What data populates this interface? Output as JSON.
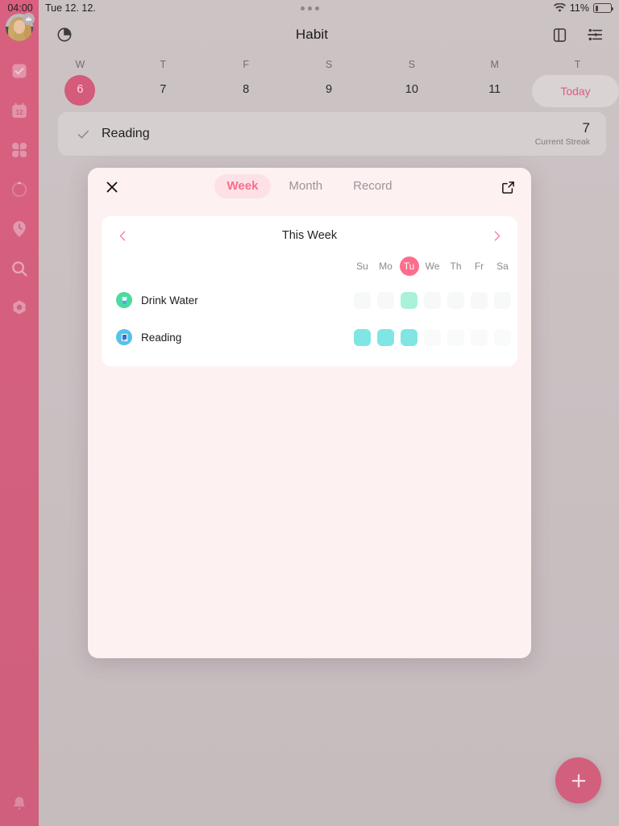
{
  "status_bar": {
    "time": "04:00",
    "date": "Tue 12. 12.",
    "wifi_icon": "wifi-icon",
    "battery_percent": "11%",
    "battery_icon": "battery-low-icon",
    "dots_icon": "dynamic-island-dots"
  },
  "sidebar": {
    "avatar_name": "user-avatar",
    "crown_icon": "crown-badge-icon",
    "items": [
      {
        "name": "sidebar-item-tasks",
        "icon": "checkbox-icon"
      },
      {
        "name": "sidebar-item-calendar",
        "icon": "calendar-12-icon"
      },
      {
        "name": "sidebar-item-habits",
        "icon": "four-squares-icon"
      },
      {
        "name": "sidebar-item-focus",
        "icon": "progress-ring-icon"
      },
      {
        "name": "sidebar-item-pomodoro",
        "icon": "clock-pin-icon"
      },
      {
        "name": "sidebar-item-search",
        "icon": "search-icon"
      },
      {
        "name": "sidebar-item-settings",
        "icon": "hex-gear-icon"
      }
    ],
    "bottom_item": {
      "name": "sidebar-item-notifications",
      "icon": "bell-icon"
    }
  },
  "appbar": {
    "title": "Habit",
    "left_icon": "pie-clock-icon",
    "right_icons": [
      {
        "name": "panel-toggle-icon"
      },
      {
        "name": "filter-sliders-icon"
      }
    ]
  },
  "week_strip": {
    "days": [
      {
        "dow": "W",
        "num": "6",
        "selected": true
      },
      {
        "dow": "T",
        "num": "7",
        "selected": false
      },
      {
        "dow": "F",
        "num": "8",
        "selected": false
      },
      {
        "dow": "S",
        "num": "9",
        "selected": false
      },
      {
        "dow": "S",
        "num": "10",
        "selected": false
      },
      {
        "dow": "M",
        "num": "11",
        "selected": false
      },
      {
        "dow": "T",
        "num": "",
        "selected": false
      }
    ],
    "today_label": "Today"
  },
  "habit_row": {
    "check_icon": "check-icon",
    "name": "Reading",
    "streak_value": "7",
    "streak_label": "Current Streak"
  },
  "fab": {
    "icon": "plus-icon",
    "label": "+"
  },
  "modal": {
    "close_icon": "close-icon",
    "expand_icon": "external-link-icon",
    "tabs": [
      {
        "label": "Week",
        "active": true
      },
      {
        "label": "Month",
        "active": false
      },
      {
        "label": "Record",
        "active": false
      }
    ],
    "week_panel": {
      "prev_icon": "chevron-left-icon",
      "next_icon": "chevron-right-icon",
      "title": "This Week",
      "day_headers": [
        {
          "label": "Su",
          "today": false
        },
        {
          "label": "Mo",
          "today": false
        },
        {
          "label": "Tu",
          "today": true
        },
        {
          "label": "We",
          "today": false
        },
        {
          "label": "Th",
          "today": false
        },
        {
          "label": "Fr",
          "today": false
        },
        {
          "label": "Sa",
          "today": false
        }
      ],
      "habits": [
        {
          "name": "Drink Water",
          "icon": "water-glass-icon",
          "icon_bg": "#4ddaa0",
          "done_color": "#a9f2d9",
          "empty_color": "#f7f8f8",
          "cells": [
            false,
            false,
            true,
            false,
            false,
            false,
            false
          ]
        },
        {
          "name": "Reading",
          "icon": "book-icon",
          "icon_bg": "#56c2e8",
          "done_color": "#7fe6e3",
          "empty_color": "#f9fafa",
          "cells": [
            true,
            true,
            true,
            false,
            false,
            false,
            false
          ]
        }
      ]
    }
  },
  "colors": {
    "sidebar_pink": "#d4607e",
    "accent_pink": "#fd6d8c",
    "tab_active_bg": "#fde1e7",
    "modal_bg": "#fdf1f1",
    "panel_white": "#ffffff",
    "backdrop": "#c8bfc1"
  }
}
